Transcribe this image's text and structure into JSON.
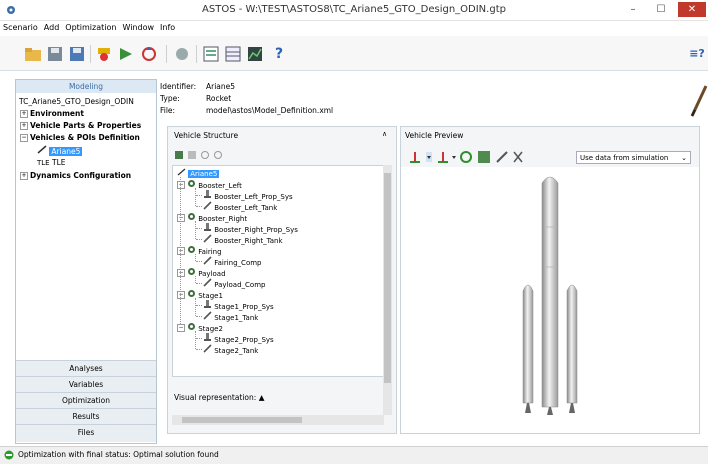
{
  "window": {
    "title": "ASTOS - W:\\TEST\\ASTOS8\\TC_Ariane5_GTO_Design_ODIN.gtp",
    "minimize": "–",
    "maximize": "☐",
    "close": "✕"
  },
  "menu": [
    "Scenario",
    "Add",
    "Optimization",
    "Window",
    "Info"
  ],
  "toolbar": {
    "help": "?",
    "right_help": "≡?"
  },
  "left": {
    "modeling_tab": "Modeling",
    "root": "TC_Ariane5_GTO_Design_ODIN",
    "items": [
      "Environment",
      "Vehicle Parts & Properties",
      "Vehicles & POIs Definition",
      "Ariane5",
      "TLE",
      "Dynamics Configuration"
    ],
    "nav": [
      "Analyses",
      "Variables",
      "Optimization",
      "Results",
      "Files"
    ]
  },
  "info": {
    "identifier_label": "Identifier:",
    "identifier": "Ariane5",
    "type_label": "Type:",
    "type": "Rocket",
    "file_label": "File:",
    "file": "model\\astos\\Model_Definition.xml"
  },
  "structure": {
    "title": "Vehicle Structure",
    "root": "Ariane5",
    "nodes": [
      {
        "label": "Booster_Left",
        "children": [
          "Booster_Left_Prop_Sys",
          "Booster_Left_Tank"
        ]
      },
      {
        "label": "Booster_Right",
        "children": [
          "Booster_Right_Prop_Sys",
          "Booster_Right_Tank"
        ]
      },
      {
        "label": "Fairing",
        "children": [
          "Fairing_Comp"
        ]
      },
      {
        "label": "Payload",
        "children": [
          "Payload_Comp"
        ]
      },
      {
        "label": "Stage1",
        "children": [
          "Stage1_Prop_Sys",
          "Stage1_Tank"
        ]
      },
      {
        "label": "Stage2",
        "children": [
          "Stage2_Prop_Sys",
          "Stage2_Tank"
        ]
      }
    ],
    "visual_representation": "Visual representation:"
  },
  "preview": {
    "title": "Vehicle Preview",
    "dropdown": "Use data from simulation"
  },
  "status": "Optimization with final status: Optimal solution found"
}
